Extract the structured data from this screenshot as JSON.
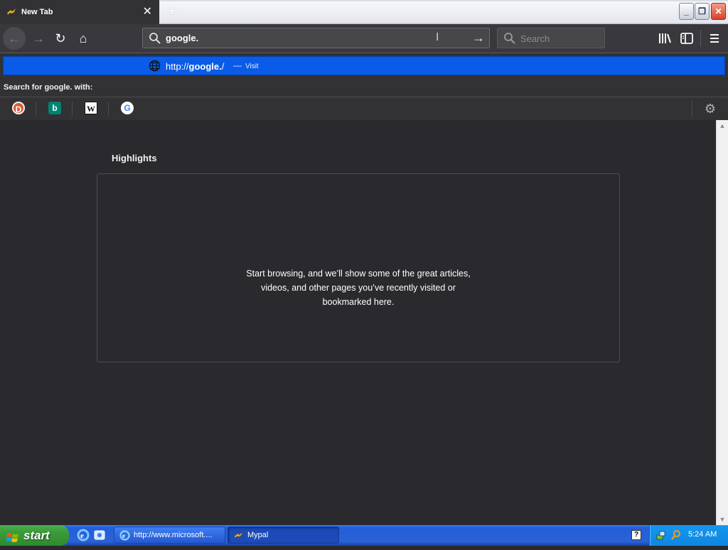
{
  "browser": {
    "tab": {
      "title": "New Tab",
      "close_glyph": "✕",
      "icon": "mypal-icon"
    },
    "new_tab_glyph": "+",
    "window_buttons": {
      "minimize": "_",
      "restore": "❐",
      "close": "✕"
    }
  },
  "navbar": {
    "back_glyph": "←",
    "forward_glyph": "→",
    "reload_glyph": "↻",
    "home_glyph": "⌂",
    "url_value": "google.",
    "go_glyph": "→",
    "search_placeholder": "Search"
  },
  "autocomplete": {
    "result": {
      "url_prefix": "http://",
      "url_bold": "google.",
      "url_suffix": "/",
      "dash": "—",
      "action": "Visit"
    },
    "search_with_label": "Search for google. with:",
    "engines": [
      {
        "name": "DuckDuckGo",
        "glyph": "D"
      },
      {
        "name": "Bing",
        "glyph": "b"
      },
      {
        "name": "Wikipedia",
        "glyph": "W"
      },
      {
        "name": "Google",
        "glyph": "G"
      }
    ],
    "settings_glyph": "⚙"
  },
  "content": {
    "highlights_title": "Highlights",
    "empty_message_line1": "Start browsing, and we’ll show some of the great articles,",
    "empty_message_line2": "videos, and other pages you’ve recently visited or",
    "empty_message_line3": "bookmarked here."
  },
  "taskbar": {
    "start_label": "start",
    "tasks": [
      {
        "label": "http://www.microsoft...."
      },
      {
        "label": "Mypal"
      }
    ],
    "help_glyph": "?",
    "clock": "5:24 AM"
  },
  "colors": {
    "accent_blue": "#0a5be8",
    "content_bg": "#2a2a2e",
    "toolbar_bg": "#38383d"
  }
}
